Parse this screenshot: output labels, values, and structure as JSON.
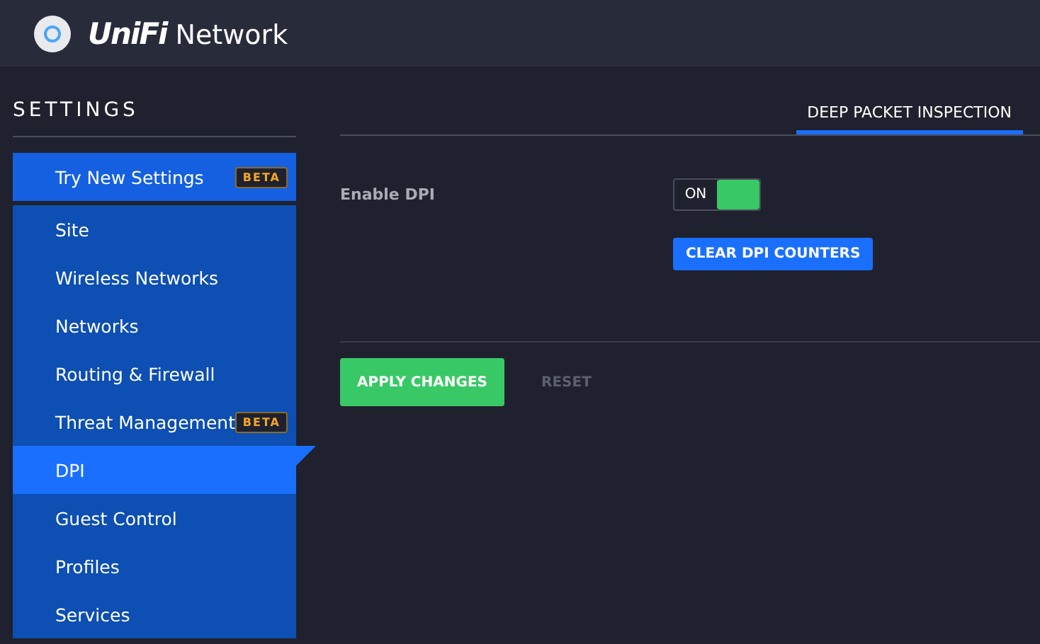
{
  "header": {
    "brand_prefix": "UniFi",
    "brand_name": "Network"
  },
  "sidebar": {
    "title": "SETTINGS",
    "promo": {
      "label": "Try New Settings",
      "badge": "BETA"
    },
    "items": [
      {
        "label": "Site",
        "selected": false
      },
      {
        "label": "Wireless Networks",
        "selected": false
      },
      {
        "label": "Networks",
        "selected": false
      },
      {
        "label": "Routing & Firewall",
        "selected": false
      },
      {
        "label": "Threat Management",
        "selected": false,
        "badge": "BETA"
      },
      {
        "label": "DPI",
        "selected": true
      },
      {
        "label": "Guest Control",
        "selected": false
      },
      {
        "label": "Profiles",
        "selected": false
      },
      {
        "label": "Services",
        "selected": false
      }
    ]
  },
  "tabs": [
    {
      "label": "DEEP PACKET INSPECTION",
      "selected": true
    }
  ],
  "settings": {
    "label": "Enable DPI",
    "toggle": {
      "text": "ON",
      "on": true
    },
    "clear_button": "CLEAR DPI COUNTERS"
  },
  "actions": {
    "apply": "APPLY CHANGES",
    "reset": "RESET"
  }
}
